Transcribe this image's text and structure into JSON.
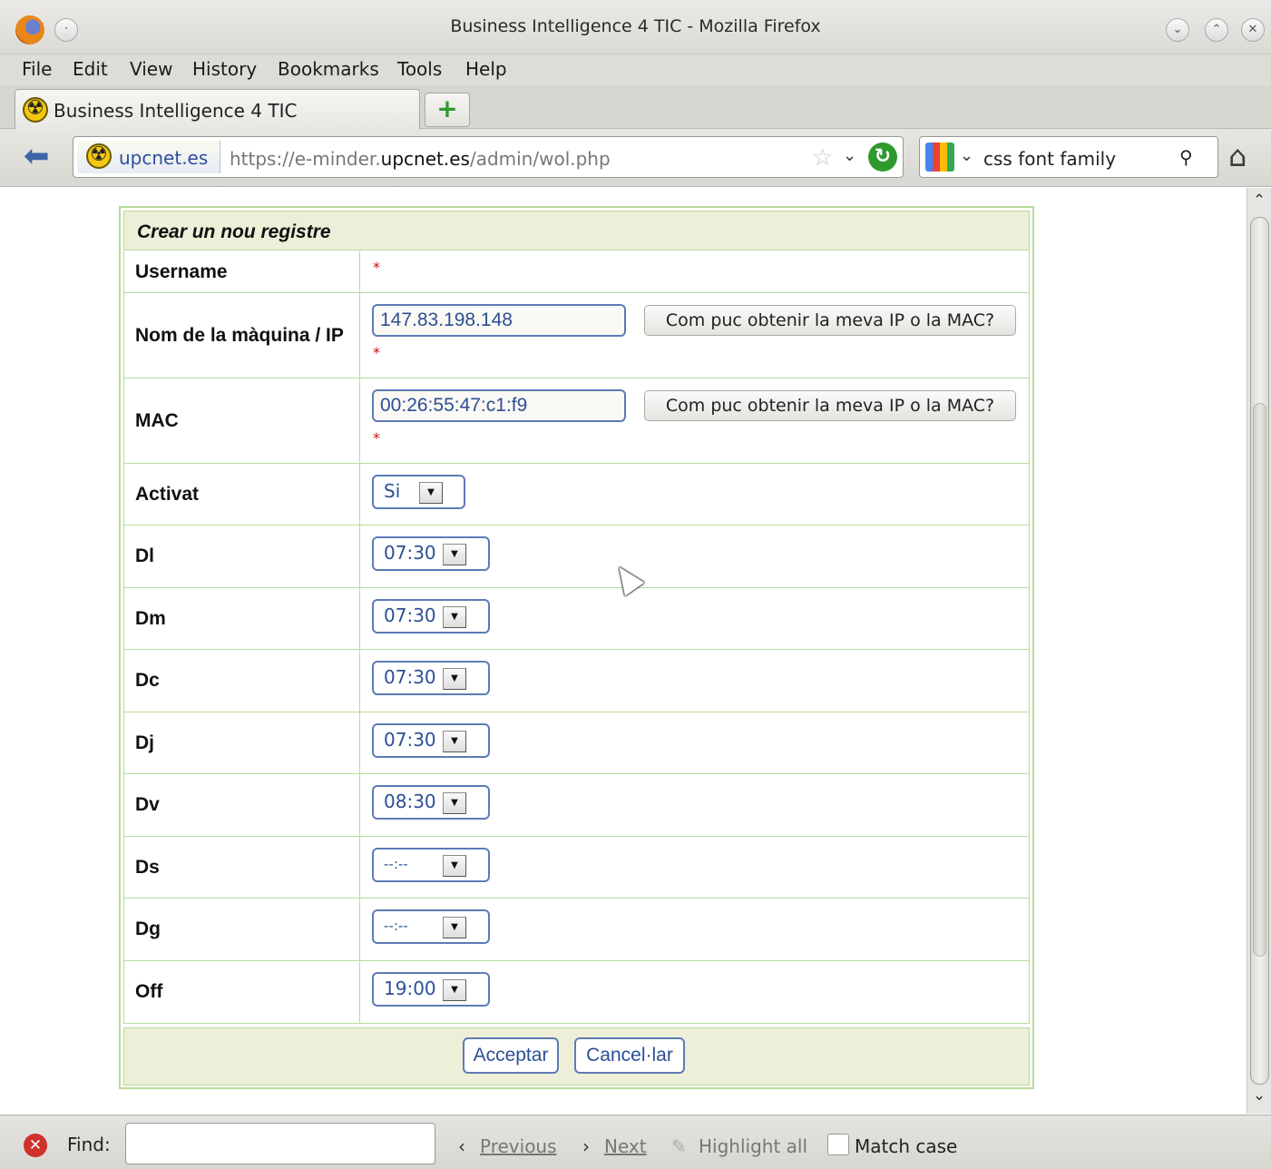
{
  "window": {
    "title": "Business Intelligence 4 TIC - Mozilla Firefox"
  },
  "menu": [
    "File",
    "Edit",
    "View",
    "History",
    "Bookmarks",
    "Tools",
    "Help"
  ],
  "tab": {
    "label": "Business Intelligence 4 TIC"
  },
  "nav": {
    "identity": "upcnet.es",
    "url_prefix": "https://e-minder.",
    "url_domain": "upcnet.es",
    "url_path": "/admin/wol.php",
    "search_text": "css font family"
  },
  "form": {
    "title": "Crear un nou registre",
    "required_mark": "*",
    "username_label": "Username",
    "machine_label": "Nom de la màquina / IP",
    "machine_value": "147.83.198.148",
    "mac_label": "MAC",
    "mac_value": "00:26:55:47:c1:f9",
    "help_button": "Com puc obtenir la meva IP o la MAC?",
    "activat_label": "Activat",
    "activat_value": "Si",
    "days": [
      {
        "label": "Dl",
        "value": "07:30"
      },
      {
        "label": "Dm",
        "value": "07:30"
      },
      {
        "label": "Dc",
        "value": "07:30"
      },
      {
        "label": "Dj",
        "value": "07:30"
      },
      {
        "label": "Dv",
        "value": "08:30"
      },
      {
        "label": "Ds",
        "value": "--:--"
      },
      {
        "label": "Dg",
        "value": "--:--"
      },
      {
        "label": "Off",
        "value": "19:00"
      }
    ],
    "accept_button": "Acceptar",
    "cancel_button": "Cancel·lar"
  },
  "findbar": {
    "label": "Find:",
    "previous": "Previous",
    "next": "Next",
    "highlight": "Highlight all",
    "match_case": "Match case"
  }
}
